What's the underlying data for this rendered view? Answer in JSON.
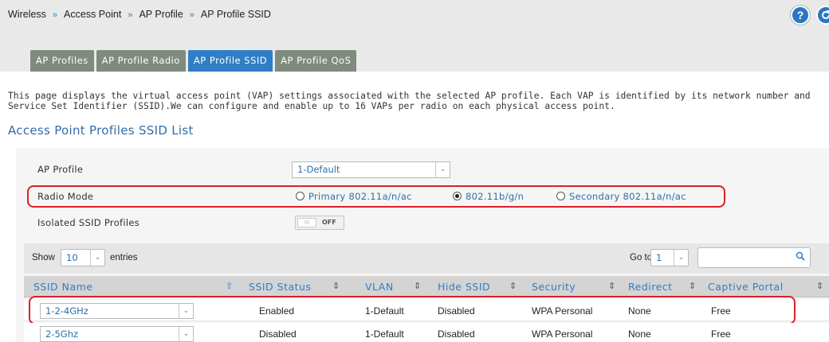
{
  "breadcrumb": [
    "Wireless",
    "Access Point",
    "AP Profile",
    "AP Profile SSID"
  ],
  "breadcrumb_separator": "»",
  "header": {
    "help_label": "?",
    "help_icon": "help-icon",
    "refresh_icon": "refresh-icon"
  },
  "tabs": [
    {
      "label": "AP Profiles",
      "active": false
    },
    {
      "label": "AP Profile Radio",
      "active": false
    },
    {
      "label": "AP Profile SSID",
      "active": true
    },
    {
      "label": "AP Profile QoS",
      "active": false
    }
  ],
  "description": {
    "line1": "This page displays the virtual access point (VAP) settings associated with the selected AP profile. Each VAP is identified by its network number and",
    "line2": "Service Set Identifier (SSID).We can configure and enable up to 16 VAPs per radio on each physical access point."
  },
  "section_title": "Access Point Profiles SSID List",
  "form": {
    "ap_profile_label": "AP Profile",
    "ap_profile_value": "1-Default",
    "radio_mode_label": "Radio Mode",
    "radio_options": [
      {
        "label": "Primary 802.11a/n/ac",
        "checked": false
      },
      {
        "label": "802.11b/g/n",
        "checked": true
      },
      {
        "label": "Secondary 802.11a/n/ac",
        "checked": false
      }
    ],
    "isolated_label": "Isolated SSID Profiles",
    "isolated_toggle_text": "OFF",
    "isolated_toggle_knob": "III"
  },
  "table_controls": {
    "show_label": "Show",
    "entries_value": "10",
    "entries_label": "entries",
    "goto_label": "Go to",
    "goto_value": "1",
    "search_placeholder": ""
  },
  "table": {
    "columns": [
      "SSID Name",
      "SSID Status",
      "VLAN",
      "Hide SSID",
      "Security",
      "Redirect",
      "Captive Portal"
    ],
    "rows": [
      {
        "ssid": "1-2-4GHz",
        "status": "Enabled",
        "vlan": "1-Default",
        "hide": "Disabled",
        "security": "WPA Personal",
        "redirect": "None",
        "portal": "Free"
      },
      {
        "ssid": "2-5Ghz",
        "status": "Disabled",
        "vlan": "1-Default",
        "hide": "Disabled",
        "security": "WPA Personal",
        "redirect": "None",
        "portal": "Free"
      }
    ]
  },
  "colors": {
    "accent": "#2f7ec6",
    "tab_inactive": "#7f8b7e",
    "highlight": "#d9202a"
  }
}
